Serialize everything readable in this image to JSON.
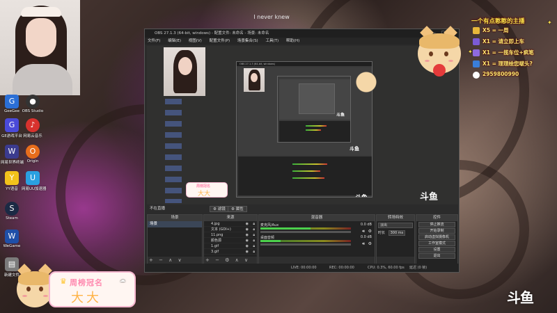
{
  "overlay": {
    "top_title": "I never knew",
    "banner_title": "一个有点憨憨的主播",
    "rank_list": [
      {
        "icon": "gift-icon",
        "color": "#e7b73a",
        "text": "X5 = 一周"
      },
      {
        "icon": "gift-icon",
        "color": "#7b5bd6",
        "text": "X1 = 请立即上车"
      },
      {
        "icon": "gift-icon",
        "color": "#8e6adf",
        "text": "X1 = 一揽车位+疯笔"
      },
      {
        "icon": "gift-icon",
        "color": "#3a7ed8",
        "text": "X1 = 理理绘您啵头?"
      }
    ],
    "qq_number": "2959800990",
    "badge_title": "周榜冠名",
    "badge_name": "大大",
    "logo_text": "斗鱼",
    "mini_badge_title": "周榜冠名",
    "mini_badge_name": "大大"
  },
  "desktop": {
    "icons": [
      {
        "label": "GeeGee",
        "color": "#2b6fd6",
        "glyph": "G",
        "name": "geegee"
      },
      {
        "label": "OBS Studio",
        "color": "#333",
        "glyph": "●",
        "name": "obs-studio"
      },
      {
        "label": "GE游戏平台",
        "color": "#4a4ad9",
        "glyph": "G",
        "name": "ge-platform"
      },
      {
        "label": "网易云音乐",
        "color": "#d8322e",
        "glyph": "♪",
        "name": "netease-music"
      },
      {
        "label": "网易世界终端",
        "color": "#3b3b8e",
        "glyph": "W",
        "name": "netease-world"
      },
      {
        "label": "Origin",
        "color": "#e86d1c",
        "glyph": "O",
        "name": "origin"
      },
      {
        "label": "YY语音",
        "color": "#f2c21b",
        "glyph": "Y",
        "name": "yy-voice"
      },
      {
        "label": "网易UU加速器",
        "color": "#2aa0e0",
        "glyph": "U",
        "name": "uu-booster"
      },
      {
        "label": "Steam",
        "color": "#1b2a44",
        "glyph": "S",
        "name": "steam"
      },
      {
        "label": "WeGame",
        "color": "#1f4fa8",
        "glyph": "W",
        "name": "wegame"
      },
      {
        "label": "新建文件",
        "color": "#7b7b7b",
        "glyph": "▤",
        "name": "new-file"
      }
    ]
  },
  "obs": {
    "title": "OBS 27.1.3 (64-bit, windows) - 配置文件: 未命名 - 场景: 未命名",
    "window_controls": "— ☐ ✕",
    "menu": [
      "文件(F)",
      "编辑(E)",
      "视图(V)",
      "配置文件(P)",
      "场景集合(S)",
      "工具(T)",
      "帮助(H)"
    ],
    "nested_title": "OBS 27.1.3 (64-bit, windows)",
    "status_row": {
      "left": "不在直播",
      "btn_filter": "滤镜",
      "btn_props": "属性"
    },
    "docks": {
      "scenes": {
        "header": "场景",
        "items": [
          "场景"
        ],
        "footer": "+ − ∧ ∨"
      },
      "sources": {
        "header": "来源",
        "items": [
          "4.jpg",
          "文本 (GDI+)",
          "11.png",
          "颜色源",
          "1.gif",
          "3.gif"
        ],
        "footer": "+ − ⚙ ∧ ∨"
      },
      "mixer": {
        "header": "混音器",
        "channels": [
          {
            "name": "麦克风/Aux",
            "db": "0.0 dB",
            "level": 0.55
          },
          {
            "name": "桌面音频",
            "db": "0.0 dB",
            "level": 0.22
          }
        ]
      },
      "transitions": {
        "header": "转场特效",
        "type": "淡出",
        "duration_label": "时长",
        "duration_value": "300 ms"
      },
      "controls": {
        "header": "控件",
        "buttons": [
          "停止推流",
          "开始录制",
          "启动虚拟摄像机",
          "工作室模式",
          "设置",
          "退出"
        ]
      }
    },
    "statusbar": {
      "live": "LIVE: 00:00:00",
      "rec": "REC: 00:00:00",
      "cpu": "CPU: 0.3%, 60.00 fps",
      "kbps": "延迟 (0 帧)"
    }
  },
  "colors": {
    "obs_bg": "#2b2b2b",
    "accent_scene": "#3b4657",
    "overlay_gold": "#ffe870",
    "badge_pink": "#ff8ab0"
  }
}
